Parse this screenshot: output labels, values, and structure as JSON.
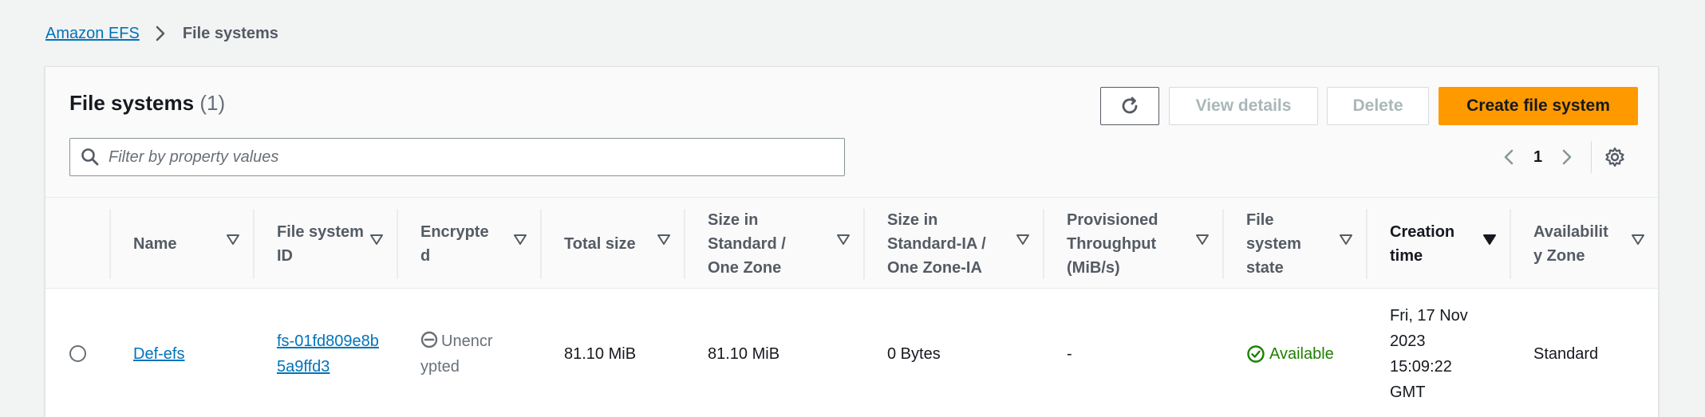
{
  "breadcrumb": {
    "root": "Amazon EFS",
    "current": "File systems"
  },
  "panel": {
    "title": "File systems",
    "count": "(1)"
  },
  "toolbar": {
    "view_details": "View details",
    "delete": "Delete",
    "create": "Create file system",
    "refresh_icon": "refresh-icon"
  },
  "search": {
    "placeholder": "Filter by property values",
    "icon": "search-icon"
  },
  "pagination": {
    "page": "1",
    "prev_icon": "chevron-left-icon",
    "next_icon": "chevron-right-icon",
    "settings_icon": "gear-icon"
  },
  "table": {
    "columns": [
      {
        "label": "Name"
      },
      {
        "label": "File system ID"
      },
      {
        "label": "Encrypted"
      },
      {
        "label": "Total size"
      },
      {
        "label": "Size in Standard / One Zone"
      },
      {
        "label": "Size in Standard-IA / One Zone-IA"
      },
      {
        "label": "Provisioned Throughput (MiB/s)"
      },
      {
        "label": "File system state"
      },
      {
        "label": "Creation time"
      },
      {
        "label": "Availability Zone"
      }
    ],
    "rows": [
      {
        "name": "Def-efs",
        "id": "fs-01fd809e8b5a9ffd3",
        "encrypted": "Unencrypted",
        "total_size": "81.10 MiB",
        "size_standard": "81.10 MiB",
        "size_ia": "0 Bytes",
        "throughput": "-",
        "state": "Available",
        "creation_time": "Fri, 17 Nov 2023 15:09:22 GMT",
        "availability_zone": "Standard"
      }
    ]
  },
  "colors": {
    "accent": "#ff9900",
    "link": "#0073bb",
    "success": "#1d8102"
  }
}
